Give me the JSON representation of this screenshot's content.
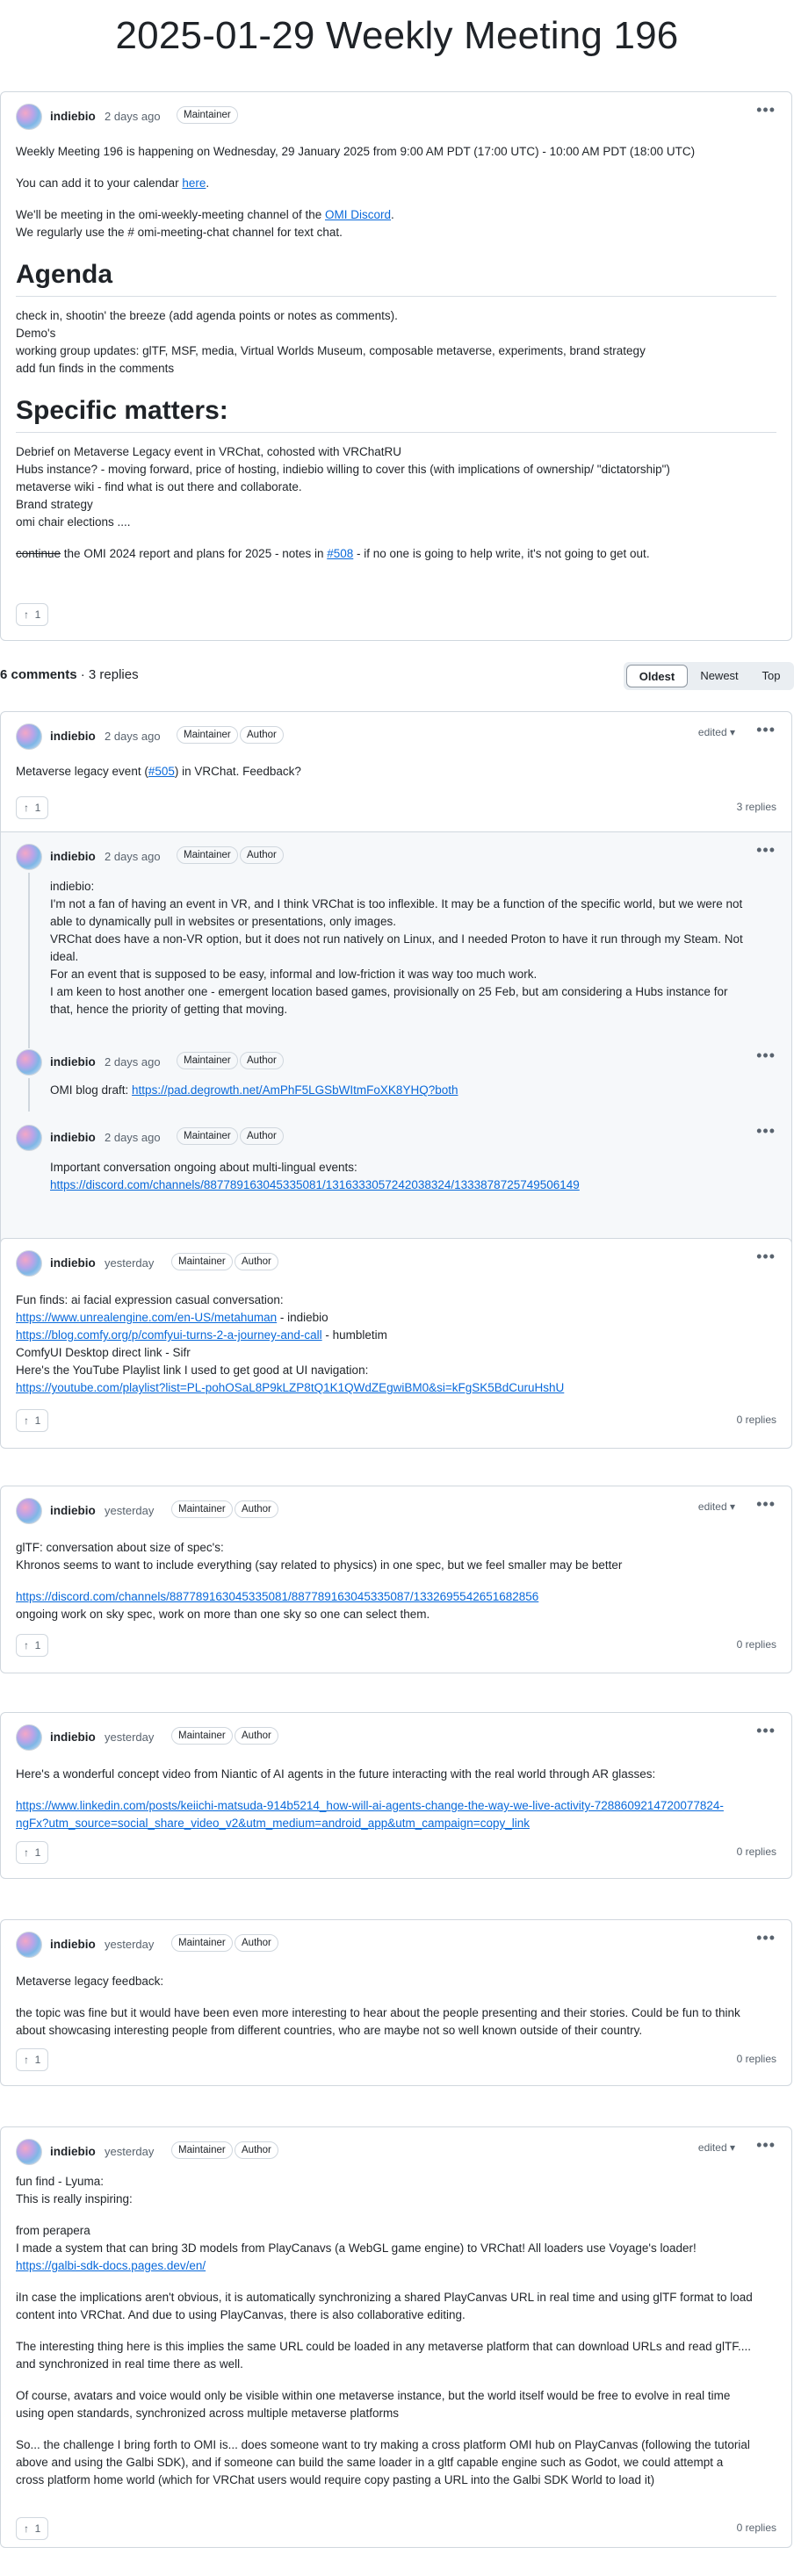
{
  "page_title": "2025-01-29 Weekly Meeting 196",
  "post": {
    "author": "indiebio",
    "when": "2 days ago",
    "role": "Maintainer",
    "p1": "Weekly Meeting 196 is happening on Wednesday, 29 January 2025 from 9:00 AM PDT (17:00 UTC) - 10:00 AM PDT (18:00 UTC)",
    "p2_pre": "You can add it to your calendar ",
    "p2_link": "here",
    "p2_post": ".",
    "p3_pre": "We'll be meeting in the omi-weekly-meeting channel of the ",
    "p3_link": "OMI Discord",
    "p3_post": ".",
    "p4": "We regularly use the # omi-meeting-chat channel for text chat.",
    "agenda_heading": "Agenda",
    "agenda": [
      "check in, shootin' the breeze (add agenda points or notes as comments).",
      "Demo's",
      "working group updates: glTF, MSF, media, Virtual Worlds Museum, composable metaverse, experiments, brand strategy",
      "add fun finds in the comments"
    ],
    "specific_heading": "Specific matters:",
    "specific": [
      "Debrief on Metaverse Legacy event in VRChat, cohosted with VRChatRU",
      "Hubs instance? - moving forward, price of hosting, indiebio willing to cover this (with implications of ownership/ \"dictatorship\")",
      "metaverse wiki - find what is out there and collaborate.",
      "Brand strategy",
      "omi chair elections ...."
    ],
    "last_strike": "continue",
    "last_pre": " the OMI 2024 report and plans for 2025 - notes in ",
    "last_link": "#508",
    "last_post": " - if no one is going to help write, it's not going to get out.",
    "votes": "1"
  },
  "summary": {
    "comments": "6 comments",
    "sep": " · ",
    "replies": "3 replies"
  },
  "sort": {
    "oldest": "Oldest",
    "newest": "Newest",
    "top": "Top"
  },
  "icons": {
    "upvote": "arrow-up-icon",
    "menu": "kebab-menu-icon",
    "edited": "caret-down-icon"
  },
  "comments": [
    {
      "author": "indiebio",
      "when": "2 days ago",
      "role": "Maintainer",
      "author_badge": "Author",
      "edited": "edited",
      "text_pre": "Metaverse legacy event (",
      "text_link": "#505",
      "text_post": ") in VRChat. Feedback?",
      "votes": "1",
      "replies": "3 replies",
      "thread": [
        {
          "author": "indiebio",
          "when": "2 days ago",
          "role": "Maintainer",
          "author_badge": "Author",
          "lines": [
            "indiebio:",
            "I'm not a fan of having an event in VR, and I think VRChat is too inflexible. It may be a function of the specific world, but we were not",
            "able to dynamically pull in websites or presentations, only images.",
            "VRChat does have a non-VR option, but it does not run natively on Linux, and I needed Proton to have it run through my Steam. Not",
            "ideal.",
            "For an event that is supposed to be easy, informal and low-friction it was way too much work.",
            "I am keen to host another one - emergent location based games, provisionally on 25 Feb, but am considering a Hubs instance for",
            "that, hence the priority of getting that moving."
          ]
        },
        {
          "author": "indiebio",
          "when": "2 days ago",
          "role": "Maintainer",
          "author_badge": "Author",
          "text_pre": "OMI blog draft: ",
          "text_link": "https://pad.degrowth.net/AmPhF5LGSbWItmFoXK8YHQ?both"
        },
        {
          "author": "indiebio",
          "when": "2 days ago",
          "role": "Maintainer",
          "author_badge": "Author",
          "line1": "Important conversation ongoing about multi-lingual events:",
          "link": "https://discord.com/channels/887789163045335081/1316333057242038324/1333878725749506149"
        }
      ]
    },
    {
      "author": "indiebio",
      "when": "yesterday",
      "role": "Maintainer",
      "author_badge": "Author",
      "l1": "Fun finds: ai facial expression casual conversation:",
      "l2_link": "https://www.unrealengine.com/en-US/metahuman",
      "l2_post": " - indiebio",
      "l3_link": "https://blog.comfy.org/p/comfyui-turns-2-a-journey-and-call",
      "l3_post": " - humbletim",
      "l4": "ComfyUI Desktop direct link - Sifr",
      "l5": "Here's the YouTube Playlist link I used to get good at UI navigation:",
      "l6_link": "https://youtube.com/playlist?list=PL-pohOSaL8P9kLZP8tQ1K1QWdZEgwiBM0&si=kFgSK5BdCuruHshU",
      "votes": "1",
      "replies": "0 replies"
    },
    {
      "author": "indiebio",
      "when": "yesterday",
      "role": "Maintainer",
      "author_badge": "Author",
      "edited": "edited",
      "l1": "glTF: conversation about size of spec's:",
      "l2": "Khronos seems to want to include everything (say related to physics) in one spec, but we feel smaller may be better",
      "l3_link": "https://discord.com/channels/887789163045335081/887789163045335087/1332695542651682856",
      "l4": "ongoing work on sky spec, work on more than one sky so one can select them.",
      "votes": "1",
      "replies": "0 replies"
    },
    {
      "author": "indiebio",
      "when": "yesterday",
      "role": "Maintainer",
      "author_badge": "Author",
      "l1": "Here's a wonderful concept video from Niantic of AI agents in the future interacting with the real world through AR glasses:",
      "link_a": "https://www.linkedin.com/posts/keiichi-matsuda-914b5214_how-will-ai-agents-change-the-way-we-live-activity-7288609214720077824-",
      "link_b": "ngFx?utm_source=social_share_video_v2&utm_medium=android_app&utm_campaign=copy_link",
      "votes": "1",
      "replies": "0 replies"
    },
    {
      "author": "indiebio",
      "when": "yesterday",
      "role": "Maintainer",
      "author_badge": "Author",
      "l1": "Metaverse legacy feedback:",
      "l2": "the topic was fine but it would have been even more interesting to hear about the people presenting and their stories. Could be fun to think",
      "l3": "about showcasing interesting people from different countries, who are maybe not so well known outside of their country.",
      "votes": "1",
      "replies": "0 replies"
    },
    {
      "author": "indiebio",
      "when": "yesterday",
      "role": "Maintainer",
      "author_badge": "Author",
      "edited": "edited",
      "l1": "fun find - Lyuma:",
      "l2": "This is really inspiring:",
      "l3": "from perapera",
      "l4": "I made a system that can bring 3D models from PlayCanavs (a WebGL game engine) to VRChat! All loaders use Voyage's loader!",
      "l5_link": "https://galbi-sdk-docs.pages.dev/en/",
      "p2a": "iIn case the implications aren't obvious, it is automatically synchronizing a shared PlayCanvas URL in real time and using glTF format to load",
      "p2b": "content into VRChat. And due to using PlayCanvas, there is also collaborative editing.",
      "p3a": "The interesting thing here is this implies the same URL could be loaded in any metaverse platform that can download URLs and read glTF....",
      "p3b": "and synchronized in real time there as well.",
      "p4a": "Of course, avatars and voice would only be visible within one metaverse instance, but the world itself would be free to evolve in real time",
      "p4b": "using open standards, synchronized across multiple metaverse platforms",
      "p5a": "So... the challenge I bring forth to OMI is... does someone want to try making a cross platform OMI hub on PlayCanvas (following the tutorial",
      "p5b": "above and using the Galbi SDK), and if someone can build the same loader in a gltf capable engine such as Godot, we could attempt a",
      "p5c": "cross platform home world (which for VRChat users would require copy pasting a URL into the Galbi SDK World to load it)",
      "votes": "1",
      "replies": "0 replies"
    }
  ]
}
